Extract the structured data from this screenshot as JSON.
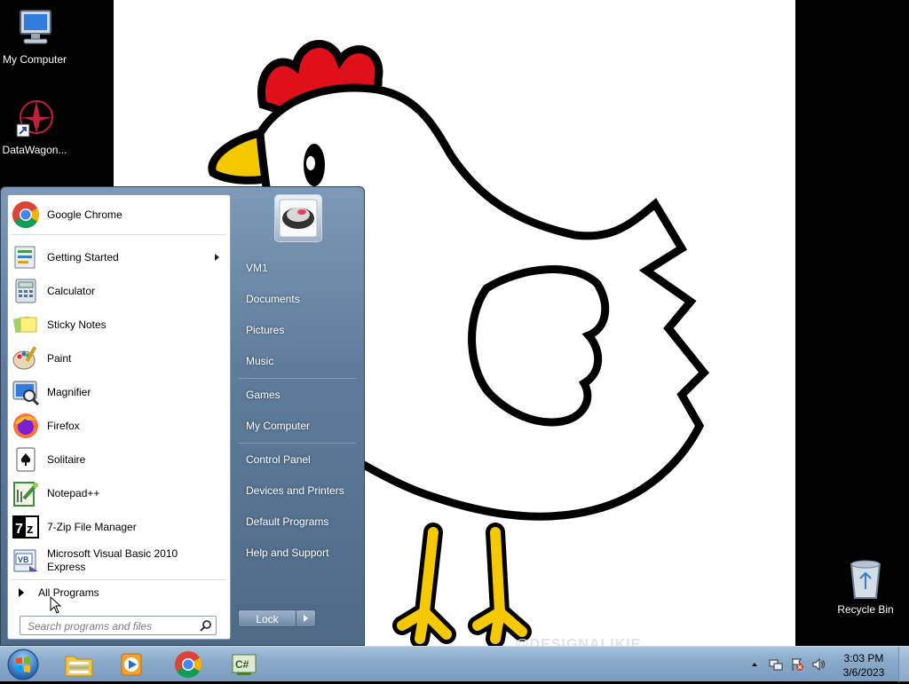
{
  "desktop": {
    "icons": [
      {
        "label": "My Computer",
        "icon": "computer-icon"
      },
      {
        "label": "DataWagon...",
        "icon": "datawagon-icon"
      },
      {
        "label": "Recycle Bin",
        "icon": "recycle-bin-icon"
      }
    ],
    "watermark": "@DESIGNALIKIE"
  },
  "start_menu": {
    "pinned": [
      {
        "label": "Google Chrome",
        "icon": "chrome-icon"
      }
    ],
    "recent": [
      {
        "label": "Getting Started",
        "icon": "getting-started-icon",
        "submenu": true
      },
      {
        "label": "Calculator",
        "icon": "calculator-icon"
      },
      {
        "label": "Sticky Notes",
        "icon": "sticky-notes-icon"
      },
      {
        "label": "Paint",
        "icon": "paint-icon"
      },
      {
        "label": "Magnifier",
        "icon": "magnifier-icon"
      },
      {
        "label": "Firefox",
        "icon": "firefox-icon"
      },
      {
        "label": "Solitaire",
        "icon": "solitaire-icon"
      },
      {
        "label": "Notepad++",
        "icon": "notepadpp-icon"
      },
      {
        "label": "7-Zip File Manager",
        "icon": "7zip-icon"
      },
      {
        "label": "Microsoft Visual Basic 2010 Express",
        "icon": "vb-icon"
      }
    ],
    "all_programs": "All Programs",
    "search_placeholder": "Search programs and files",
    "right_pane": {
      "user": "VM1",
      "items": [
        "Documents",
        "Pictures",
        "Music",
        "Games",
        "My Computer",
        "Control Panel",
        "Devices and Printers",
        "Default Programs",
        "Help and Support"
      ]
    },
    "lock_label": "Lock"
  },
  "taskbar": {
    "apps": [
      "explorer-icon",
      "media-player-icon",
      "chrome-icon",
      "csharp-icon"
    ],
    "clock": {
      "time": "3:03 PM",
      "date": "3/6/2023"
    },
    "tray_icons": [
      "show-hidden-icons-arrow",
      "network-icon",
      "action-center-icon",
      "volume-icon"
    ]
  },
  "colors": {
    "start_menu_bg": "#5f7c9c",
    "taskbar_bg": "#8aaacb",
    "chicken_comb": "#e0101a",
    "chicken_beak": "#f5c800"
  }
}
